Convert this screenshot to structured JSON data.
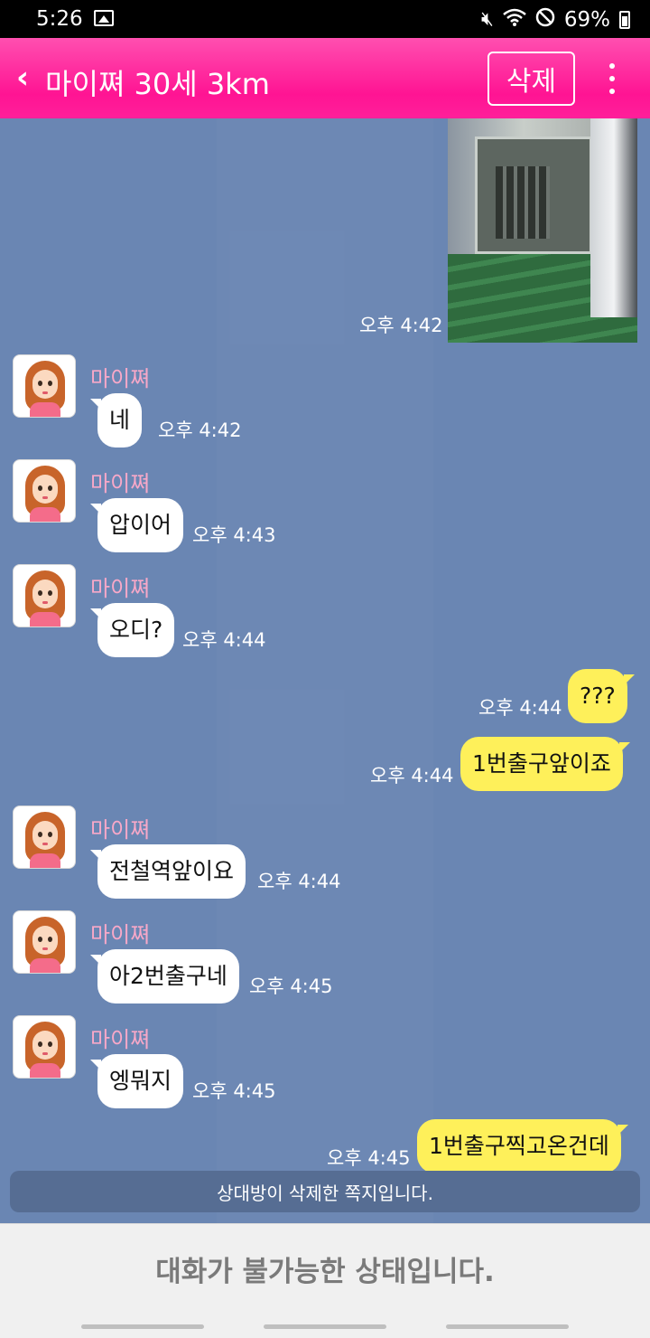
{
  "status_bar": {
    "time": "5:26",
    "battery": "69%",
    "icons": [
      "image-icon",
      "mute-icon",
      "wifi-icon",
      "block-icon",
      "battery-icon"
    ]
  },
  "header": {
    "back_icon": "chevron-left-icon",
    "title": "마이쪄 30세 3km",
    "delete_label": "삭제",
    "more_icon": "more-vert-icon",
    "color": "#ff1493"
  },
  "messages": [
    {
      "from": "me",
      "type": "image",
      "time": "오후 4:42"
    },
    {
      "from": "them",
      "sender": "마이쪄",
      "text": "네",
      "time": "오후 4:42"
    },
    {
      "from": "them",
      "sender": "마이쪄",
      "text": "압이어",
      "time": "오후 4:43"
    },
    {
      "from": "them",
      "sender": "마이쪄",
      "text": "오디?",
      "time": "오후 4:44"
    },
    {
      "from": "me",
      "text": "???",
      "time": "오후 4:44"
    },
    {
      "from": "me",
      "text": "1번출구앞이죠",
      "time": "오후 4:44"
    },
    {
      "from": "them",
      "sender": "마이쪄",
      "text": "전철역앞이요",
      "time": "오후 4:44"
    },
    {
      "from": "them",
      "sender": "마이쪄",
      "text": "아2번출구네",
      "time": "오후 4:45"
    },
    {
      "from": "them",
      "sender": "마이쪄",
      "text": "엥뭐지",
      "time": "오후 4:45"
    },
    {
      "from": "me",
      "text": "1번출구찍고온건데",
      "time": "오후 4:45"
    }
  ],
  "notice": "상대방이 삭제한 쪽지입니다.",
  "footer": "대화가 불가능한 상태입니다.",
  "colors": {
    "chat_background": "#6a86b3",
    "my_bubble": "#fef05a",
    "their_bubble": "#ffffff",
    "sender_name": "#f8a8c8"
  }
}
